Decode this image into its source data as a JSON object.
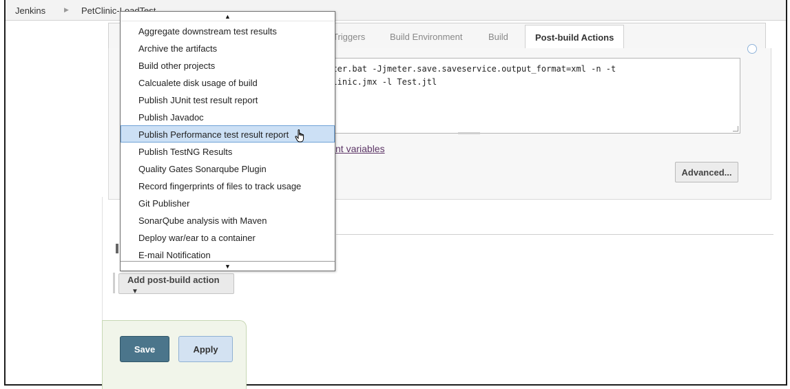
{
  "breadcrumb": {
    "root": "Jenkins",
    "project": "PetClinic-LoadTest"
  },
  "tabs": [
    {
      "label": "Triggers"
    },
    {
      "label": "Build Environment"
    },
    {
      "label": "Build"
    },
    {
      "label": "Post-build Actions"
    }
  ],
  "command": {
    "line1": "meter.bat -Jjmeter.save.saveservice.output_format=xml -n -t",
    "line2": "tClinic.jmx -l Test.jtl"
  },
  "env_link": "nt variables",
  "advanced_label": "Advanced...",
  "add_post_build_label": "Add post-build action",
  "save_label": "Save",
  "apply_label": "Apply",
  "dropdown": {
    "hovered_index": 6,
    "items": [
      "Aggregate downstream test results",
      "Archive the artifacts",
      "Build other projects",
      "Calcualete disk usage of build",
      "Publish JUnit test result report",
      "Publish Javadoc",
      "Publish Performance test result report",
      "Publish TestNG Results",
      "Quality Gates Sonarqube Plugin",
      "Record fingerprints of files to track usage",
      "Git Publisher",
      "SonarQube analysis with Maven",
      "Deploy war/ear to a container",
      "E-mail Notification"
    ]
  },
  "colors": {
    "save_button": "#4b758b",
    "apply_button": "#d3e2f2",
    "hover_item": "#cce0f5"
  }
}
